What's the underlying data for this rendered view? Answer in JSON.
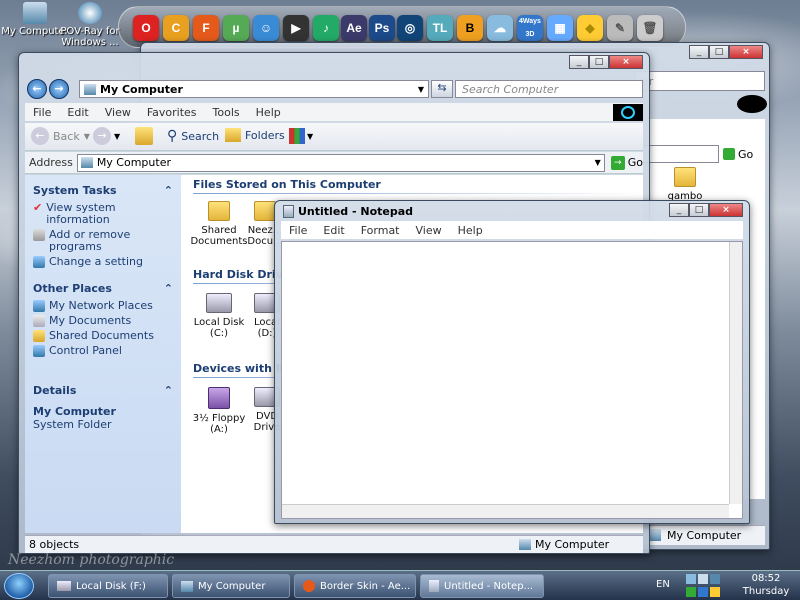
{
  "desktop": {
    "icons": [
      {
        "label": "My Computer"
      },
      {
        "label": "POV-Ray for Windows ..."
      }
    ],
    "watermark": "Neezhom photographic"
  },
  "dock": {
    "items": [
      "O",
      "C",
      "F",
      "µ",
      "☺",
      "▶",
      "♪",
      "Ae",
      "Ps",
      "◎",
      "TL",
      "B",
      "☁",
      "4Ways 3D",
      "▦",
      "◆",
      "✎",
      "🗑"
    ]
  },
  "explorer": {
    "address_title": "My Computer",
    "search_placeholder": "Search Computer",
    "menu": [
      "File",
      "Edit",
      "View",
      "Favorites",
      "Tools",
      "Help"
    ],
    "toolbar": {
      "back": "Back",
      "search": "Search",
      "folders": "Folders"
    },
    "address_label": "Address",
    "address_value": "My Computer",
    "go_label": "Go",
    "system_tasks": {
      "title": "System Tasks",
      "items": [
        "View system information",
        "Add or remove programs",
        "Change a setting"
      ]
    },
    "other_places": {
      "title": "Other Places",
      "items": [
        "My Network Places",
        "My Documents",
        "Shared Documents",
        "Control Panel"
      ]
    },
    "details": {
      "title": "Details",
      "name": "My Computer",
      "type": "System Folder"
    },
    "sections": {
      "files": "Files Stored on This Computer",
      "hdd": "Hard Disk Drives",
      "removable": "Devices with Removable Storage"
    },
    "items": {
      "shared_docs": "Shared Documents",
      "neez_docs": "Neez... Docu...",
      "local_c": "Local Disk (C:)",
      "local_d": "Local (D:)",
      "floppy": "3½ Floppy (A:)",
      "dvd": "DVD Drive"
    },
    "status_left": "8 objects",
    "status_right": "My Computer"
  },
  "explorer_back": {
    "search_hint": "er",
    "go_label": "Go",
    "folder_label": "gambo",
    "status_right": "My Computer"
  },
  "notepad": {
    "title": "Untitled - Notepad",
    "menu": [
      "File",
      "Edit",
      "Format",
      "View",
      "Help"
    ],
    "text": ""
  },
  "taskbar": {
    "buttons": [
      {
        "label": "Local Disk (F:)"
      },
      {
        "label": "My Computer"
      },
      {
        "label": "Border Skin - Ae..."
      },
      {
        "label": "Untitled - Notep..."
      }
    ],
    "language": "EN",
    "time": "08:52",
    "day": "Thursday"
  },
  "colors": {
    "accent": "#1c3e73",
    "close": "#c33"
  }
}
